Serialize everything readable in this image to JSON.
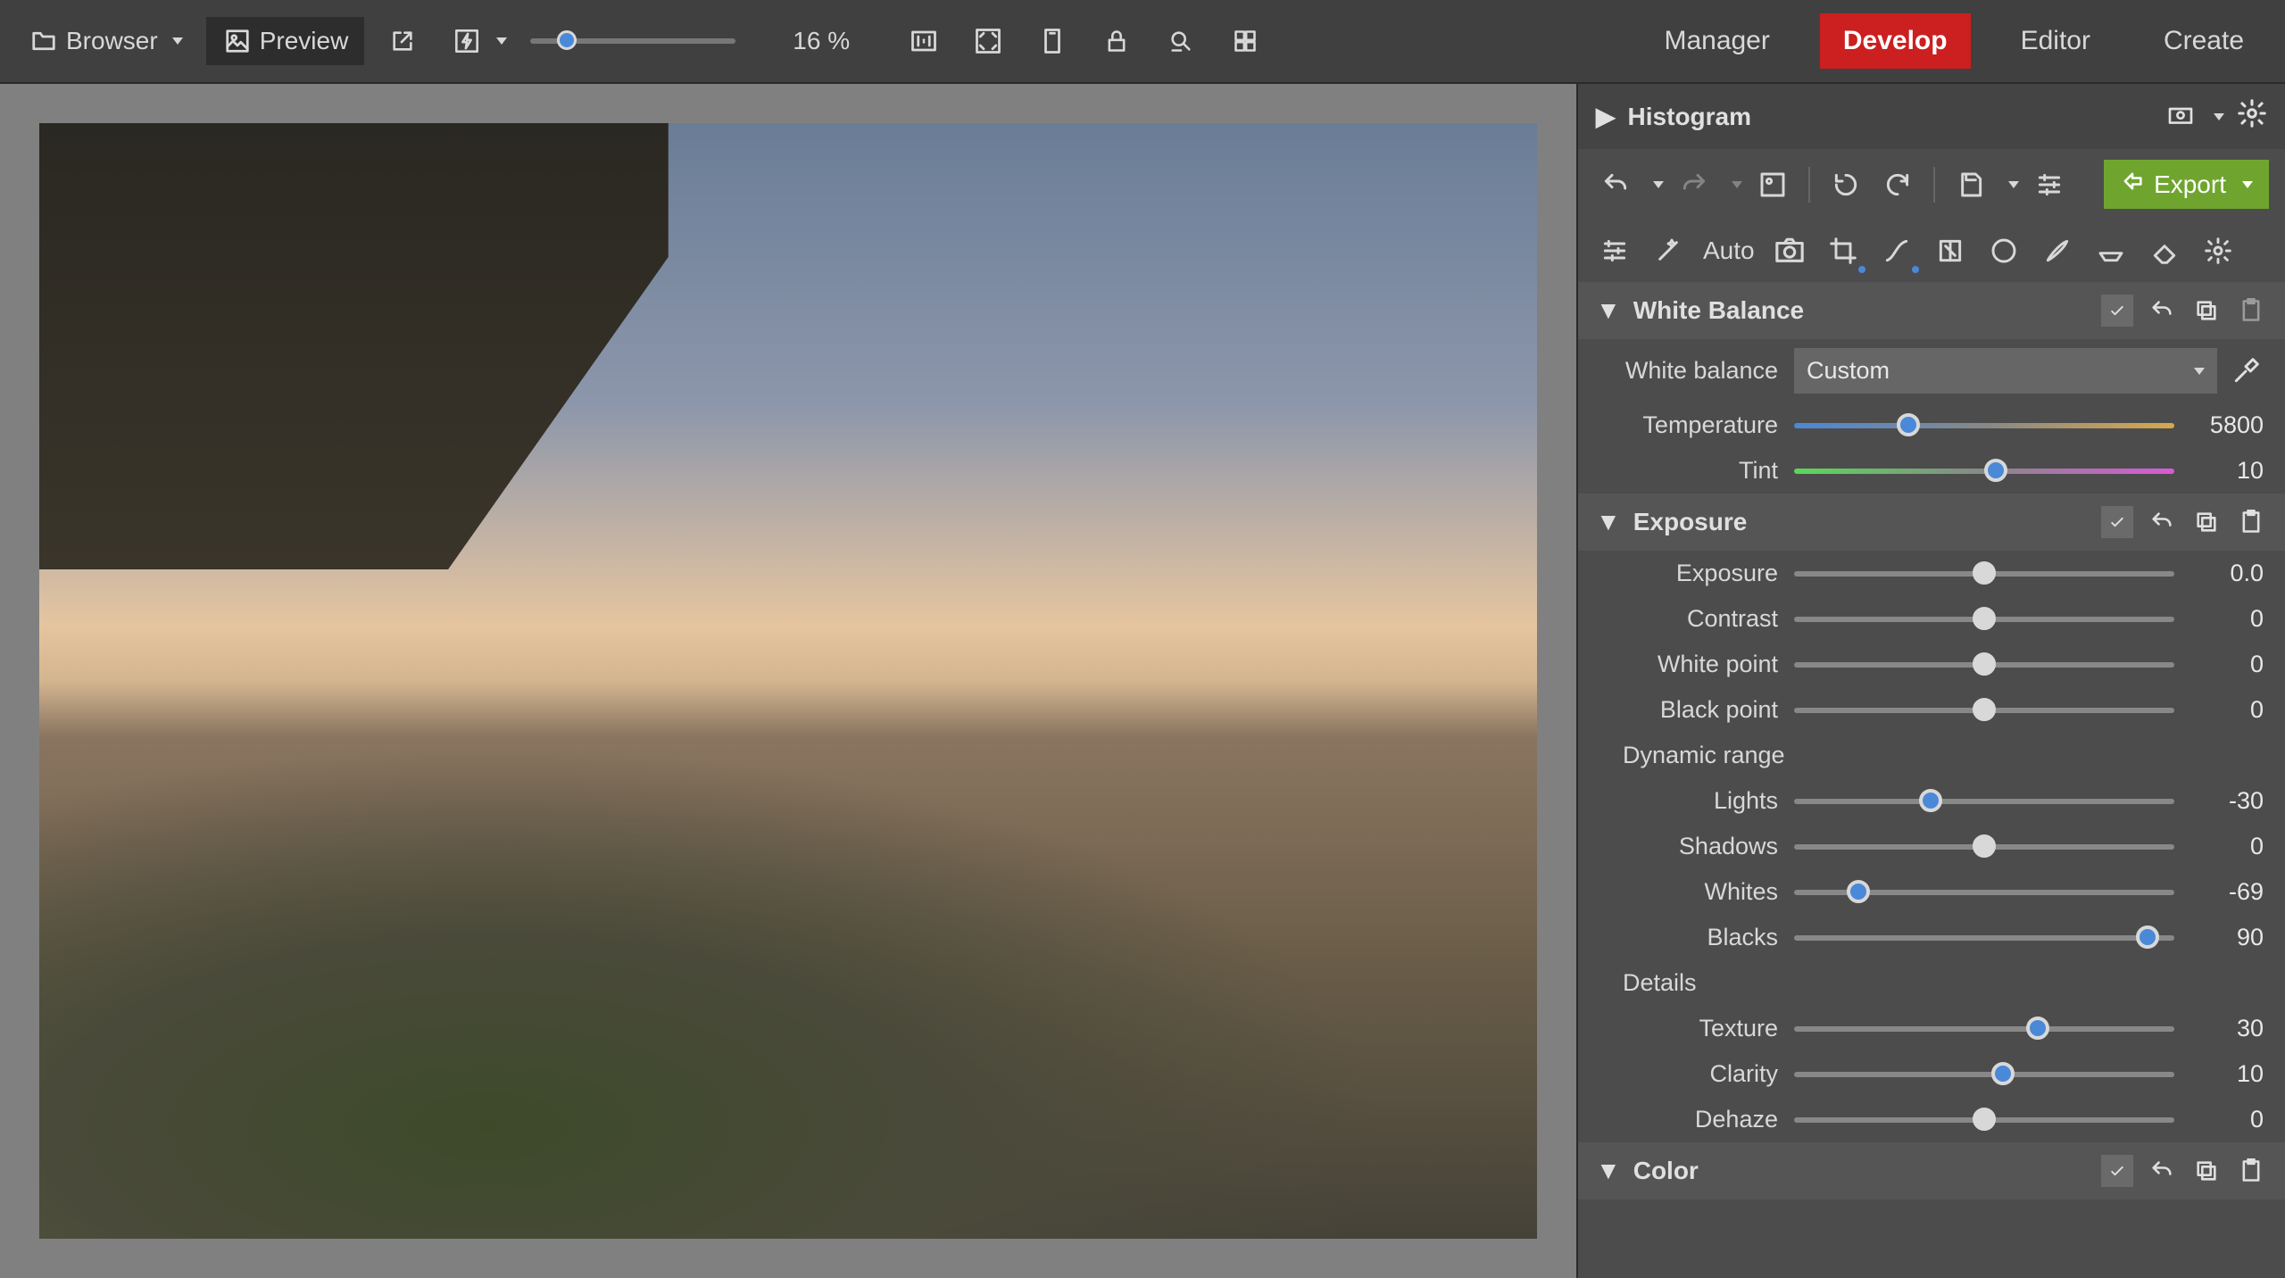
{
  "toolbar": {
    "browser_label": "Browser",
    "preview_label": "Preview",
    "zoom_label": "16 %"
  },
  "tabs": {
    "manager": "Manager",
    "develop": "Develop",
    "editor": "Editor",
    "create": "Create"
  },
  "histogram": {
    "title": "Histogram"
  },
  "export_label": "Export",
  "auto_label": "Auto",
  "wb": {
    "title": "White Balance",
    "mode_label": "White balance",
    "mode_value": "Custom",
    "temperature_label": "Temperature",
    "temperature_value": "5800",
    "tint_label": "Tint",
    "tint_value": "10"
  },
  "exposure": {
    "title": "Exposure",
    "exposure_label": "Exposure",
    "exposure_value": "0.0",
    "contrast_label": "Contrast",
    "contrast_value": "0",
    "whitepoint_label": "White point",
    "whitepoint_value": "0",
    "blackpoint_label": "Black point",
    "blackpoint_value": "0",
    "dynamic_range_label": "Dynamic range",
    "lights_label": "Lights",
    "lights_value": "-30",
    "shadows_label": "Shadows",
    "shadows_value": "0",
    "whites_label": "Whites",
    "whites_value": "-69",
    "blacks_label": "Blacks",
    "blacks_value": "90",
    "details_label": "Details",
    "texture_label": "Texture",
    "texture_value": "30",
    "clarity_label": "Clarity",
    "clarity_value": "10",
    "dehaze_label": "Dehaze",
    "dehaze_value": "0"
  },
  "color": {
    "title": "Color"
  }
}
